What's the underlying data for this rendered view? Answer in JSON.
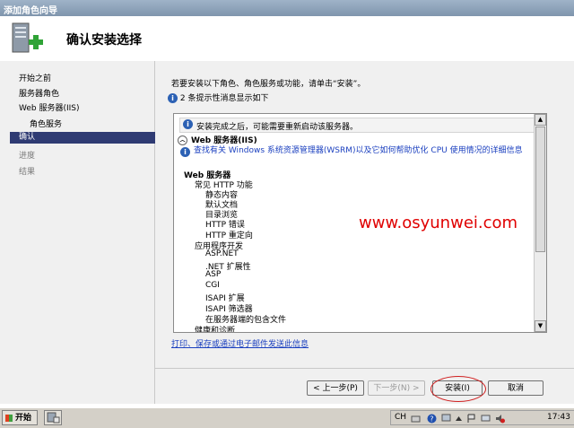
{
  "window": {
    "title": "添加角色向导"
  },
  "header": {
    "title": "确认安装选择",
    "icon": "server-add-icon"
  },
  "nav": {
    "items": [
      {
        "label": "开始之前"
      },
      {
        "label": "服务器角色"
      },
      {
        "label": "Web 服务器(IIS)"
      },
      {
        "label": "角色服务"
      },
      {
        "label": "确认"
      },
      {
        "label": "进度"
      },
      {
        "label": "结果"
      }
    ]
  },
  "main": {
    "instruction": "若要安装以下角色、角色服务或功能，请单击“安装”。",
    "info_count": "2 条提示性消息显示如下",
    "notice": "安装完成之后，可能需要重新启动该服务器。",
    "section_title": "Web 服务器(IIS)",
    "link_text": "查找有关 Windows 系统资源管理器(WSRM)以及它如何帮助优化 CPU 使用情况的详细信息",
    "tree": [
      "Web 服务器",
      "常见 HTTP 功能",
      "静态内容",
      "默认文档",
      "目录浏览",
      "HTTP 错误",
      "HTTP 重定向",
      "应用程序开发",
      "ASP.NET",
      ".NET 扩展性",
      "ASP",
      "CGI",
      "ISAPI 扩展",
      "ISAPI 筛选器",
      "在服务器端的包含文件",
      "健康和诊断"
    ],
    "print_link": "打印、保存或通过电子邮件发送此信息"
  },
  "buttons": {
    "prev": "< 上一步(P)",
    "next": "下一步(N) >",
    "install": "安装(I)",
    "cancel": "取消"
  },
  "watermark": "www.osyunwei.com",
  "taskbar": {
    "start": "开始",
    "lang": "CH",
    "time": "17:43"
  }
}
